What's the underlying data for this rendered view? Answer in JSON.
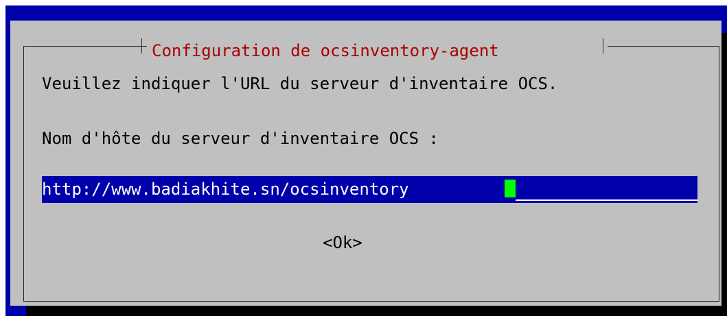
{
  "dialog": {
    "title": "Configuration de ocsinventory-agent",
    "prompt": "Veuillez indiquer l'URL du serveur d'inventaire OCS.",
    "field_label": "Nom d'hôte du serveur d'inventaire OCS :",
    "field_value": "http://www.badiakhite.sn/ocsinventory",
    "ok_label": "<Ok>"
  },
  "colors": {
    "screen_background": "#0000aa",
    "dialog_background": "#c0c0c0",
    "title_text": "#a80000",
    "input_background": "#0000aa",
    "input_text": "#ffffff",
    "cursor": "#00ff00"
  }
}
